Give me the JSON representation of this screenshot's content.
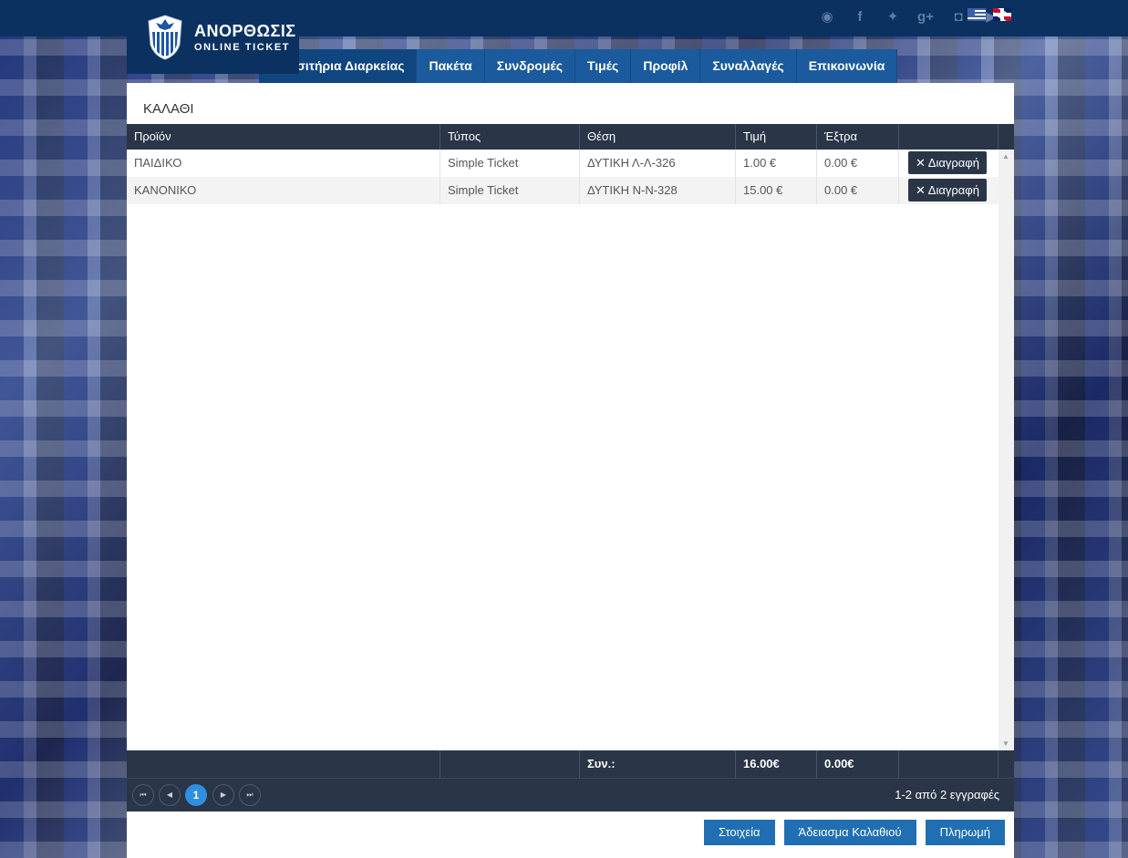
{
  "brand": {
    "name": "ΑΝΟΡΘΩΣΙΣ",
    "subtitle": "ONLINE TICKET"
  },
  "social_icons": [
    "globe-icon",
    "facebook-icon",
    "twitter-icon",
    "googleplus-icon",
    "instagram-icon",
    "youtube-icon"
  ],
  "languages": [
    "greek-flag",
    "english-flag"
  ],
  "nav": {
    "items": [
      {
        "label": "Εισιτήρια Διαρκείας"
      },
      {
        "label": "Πακέτα"
      },
      {
        "label": "Συνδρομές"
      },
      {
        "label": "Τιμές"
      },
      {
        "label": "Προφίλ"
      },
      {
        "label": "Συναλλαγές"
      },
      {
        "label": "Επικοινωνία"
      }
    ]
  },
  "cart": {
    "title": "ΚΑΛΑΘΙ",
    "columns": [
      "Προϊόν",
      "Τύπος",
      "Θέση",
      "Τιμή",
      "Έξτρα"
    ],
    "rows": [
      {
        "product": "ΠΑΙΔΙΚΟ",
        "type": "Simple Ticket",
        "seat": "ΔΥΤΙΚΗ Λ-Λ-326",
        "price": "1.00 €",
        "extra": "0.00 €",
        "delete": "Διαγραφή"
      },
      {
        "product": "ΚΑΝΟΝΙΚΟ",
        "type": "Simple Ticket",
        "seat": "ΔΥΤΙΚΗ Ν-Ν-328",
        "price": "15.00 €",
        "extra": "0.00 €",
        "delete": "Διαγραφή"
      }
    ],
    "footer": {
      "sum_label": "Συν.:",
      "total_price": "16.00€",
      "total_extra": "0.00€"
    },
    "pager": {
      "first": "⏮",
      "prev": "◀",
      "current": "1",
      "next": "▶",
      "last": "⏭",
      "info": "1-2 από 2 εγγραφές"
    }
  },
  "actions": {
    "details": "Στοιχεία",
    "empty": "Άδειασμα Καλαθιού",
    "pay": "Πληρωμή"
  }
}
